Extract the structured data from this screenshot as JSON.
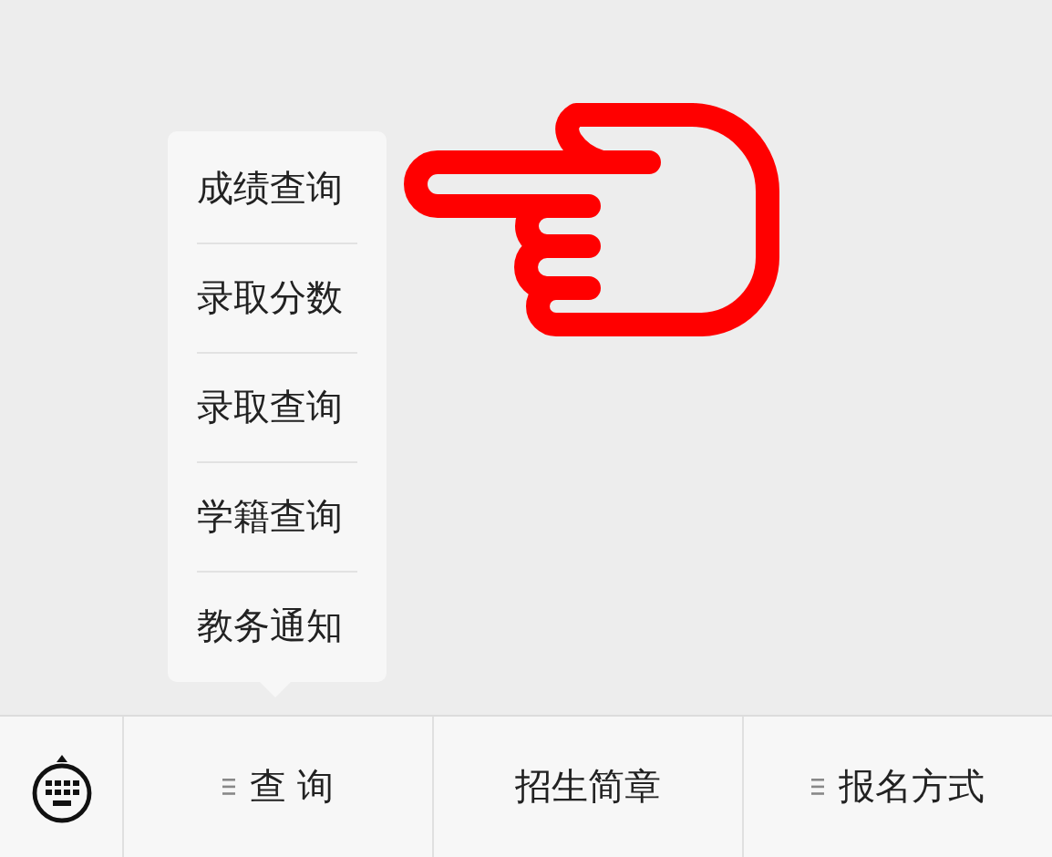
{
  "menu_bar": {
    "items": [
      {
        "label": "查 询",
        "has_submenu": true,
        "submenu": [
          {
            "label": "成绩查询"
          },
          {
            "label": "录取分数"
          },
          {
            "label": "录取查询"
          },
          {
            "label": "学籍查询"
          },
          {
            "label": "教务通知"
          }
        ]
      },
      {
        "label": "招生简章",
        "has_submenu": false
      },
      {
        "label": "报名方式",
        "has_submenu": true
      }
    ]
  }
}
